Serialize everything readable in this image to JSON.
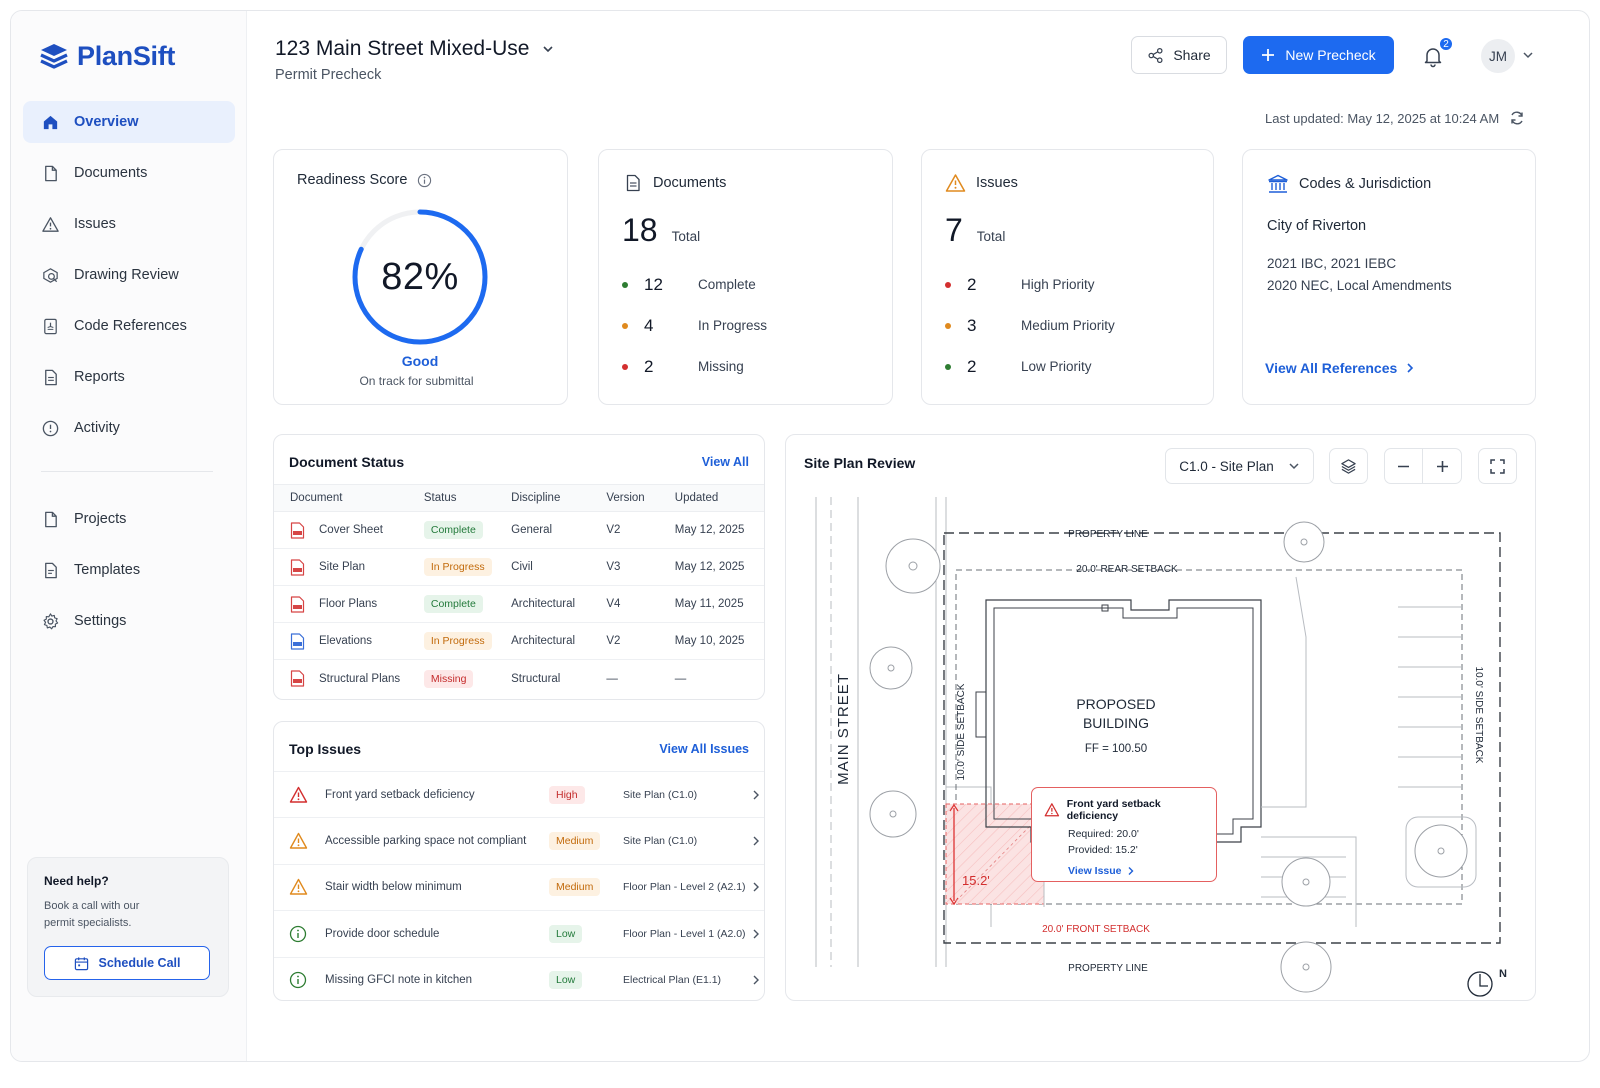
{
  "brand": {
    "name": "PlanSift",
    "color": "#1e4fc0",
    "accent": "#1d6af0"
  },
  "sidebar": {
    "items": [
      {
        "label": "Overview",
        "icon": "home-icon",
        "active": true
      },
      {
        "label": "Documents",
        "icon": "file-icon"
      },
      {
        "label": "Issues",
        "icon": "warning-icon"
      },
      {
        "label": "Drawing Review",
        "icon": "drawing-review-icon"
      },
      {
        "label": "Code References",
        "icon": "code-reference-icon"
      },
      {
        "label": "Reports",
        "icon": "report-icon"
      },
      {
        "label": "Activity",
        "icon": "activity-icon"
      }
    ],
    "secondary": [
      {
        "label": "Projects",
        "icon": "file-icon"
      },
      {
        "label": "Templates",
        "icon": "template-icon"
      },
      {
        "label": "Settings",
        "icon": "gear-icon"
      }
    ],
    "help": {
      "title": "Need help?",
      "text": "Book a call with our permit specialists.",
      "button": "Schedule Call"
    }
  },
  "header": {
    "project_title": "123 Main Street Mixed-Use",
    "subtitle": "Permit Precheck",
    "share_label": "Share",
    "new_label": "New Precheck",
    "notification_count": "2",
    "avatar_initials": "JM",
    "last_updated": "Last updated: May 12, 2025 at 10:24 AM"
  },
  "readiness": {
    "title": "Readiness Score",
    "value": "82%",
    "percent": 82,
    "status": "Good",
    "note": "On track for submittal"
  },
  "documents_card": {
    "title": "Documents",
    "total": "18",
    "total_label": "Total",
    "rows": [
      {
        "num": "12",
        "label": "Complete",
        "color": "#2e7d32"
      },
      {
        "num": "4",
        "label": "In Progress",
        "color": "#e08a1e"
      },
      {
        "num": "2",
        "label": "Missing",
        "color": "#d32f2f"
      }
    ]
  },
  "issues_card": {
    "title": "Issues",
    "total": "7",
    "total_label": "Total",
    "rows": [
      {
        "num": "2",
        "label": "High Priority",
        "color": "#d32f2f"
      },
      {
        "num": "3",
        "label": "Medium Priority",
        "color": "#e08a1e"
      },
      {
        "num": "2",
        "label": "Low Priority",
        "color": "#2e7d32"
      }
    ]
  },
  "codes_card": {
    "title": "Codes & Jurisdiction",
    "jurisdiction": "City of Riverton",
    "codes_line1": "2021 IBC, 2021 IEBC",
    "codes_line2": "2020 NEC, Local Amendments",
    "link": "View All References"
  },
  "doc_status": {
    "title": "Document Status",
    "view_all": "View All",
    "columns": [
      "Document",
      "Status",
      "Discipline",
      "Version",
      "Updated"
    ],
    "rows": [
      {
        "name": "Cover Sheet",
        "status": "Complete",
        "cls": "p-complete",
        "discipline": "General",
        "version": "V2",
        "updated": "May 12, 2025",
        "icon_color": "#d64545"
      },
      {
        "name": "Site Plan",
        "status": "In Progress",
        "cls": "p-progress",
        "discipline": "Civil",
        "version": "V3",
        "updated": "May 12, 2025",
        "icon_color": "#d64545"
      },
      {
        "name": "Floor Plans",
        "status": "Complete",
        "cls": "p-complete",
        "discipline": "Architectural",
        "version": "V4",
        "updated": "May 11, 2025",
        "icon_color": "#d64545"
      },
      {
        "name": "Elevations",
        "status": "In Progress",
        "cls": "p-progress",
        "discipline": "Architectural",
        "version": "V2",
        "updated": "May 10, 2025",
        "icon_color": "#3b6fd8"
      },
      {
        "name": "Structural Plans",
        "status": "Missing",
        "cls": "p-missing",
        "discipline": "Structural",
        "version": "—",
        "updated": "—",
        "icon_color": "#d64545"
      }
    ]
  },
  "top_issues": {
    "title": "Top Issues",
    "view_all": "View All Issues",
    "rows": [
      {
        "text": "Front yard setback deficiency",
        "priority": "High",
        "cls": "p-high",
        "location": "Site Plan (C1.0)",
        "icon": "warning-icon",
        "icon_color": "#d32f2f"
      },
      {
        "text": "Accessible parking space not compliant",
        "priority": "Medium",
        "cls": "p-medium",
        "location": "Site Plan (C1.0)",
        "icon": "warning-icon",
        "icon_color": "#e08a1e"
      },
      {
        "text": "Stair width below minimum",
        "priority": "Medium",
        "cls": "p-medium",
        "location": "Floor Plan - Level 2 (A2.1)",
        "icon": "warning-icon",
        "icon_color": "#e08a1e"
      },
      {
        "text": "Provide door schedule",
        "priority": "Low",
        "cls": "p-low",
        "location": "Floor Plan - Level 1 (A2.0)",
        "icon": "info-icon",
        "icon_color": "#2e7d32"
      },
      {
        "text": "Missing GFCI note in kitchen",
        "priority": "Low",
        "cls": "p-low",
        "location": "Electrical Plan (E1.1)",
        "icon": "info-icon",
        "icon_color": "#2e7d32"
      }
    ]
  },
  "site_plan": {
    "title": "Site Plan Review",
    "sheet": "C1.0 - Site Plan",
    "labels": {
      "property_line_top": "PROPERTY LINE",
      "rear_setback": "20.0' REAR SETBACK",
      "side_setback_left": "10.0' SIDE SETBACK",
      "side_setback_right": "10.0' SIDE SETBACK",
      "main_street": "MAIN STREET",
      "building_1": "PROPOSED",
      "building_2": "BUILDING",
      "ff": "FF = 100.50",
      "front_setback": "20.0' FRONT SETBACK",
      "property_line_bottom": "PROPERTY LINE",
      "dimension": "15.2'",
      "north": "N"
    },
    "callout": {
      "title": "Front yard setback deficiency",
      "required": "Required: 20.0'",
      "provided": "Provided: 15.2'",
      "link": "View Issue"
    }
  }
}
